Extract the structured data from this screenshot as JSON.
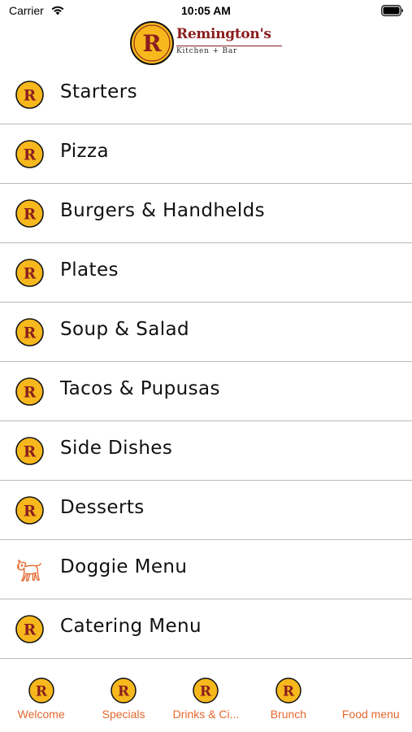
{
  "status_bar": {
    "carrier": "Carrier",
    "time": "10:05 AM"
  },
  "header": {
    "brand_name": "Remington's",
    "brand_sub": "Kitchen + Bar",
    "logo_letter": "R"
  },
  "colors": {
    "brand_red": "#8b1e1e",
    "badge_gold": "#f6b81d",
    "tab_orange": "#e4672e"
  },
  "menu": {
    "items": [
      {
        "label": "Starters",
        "icon": "remingtons-r-icon"
      },
      {
        "label": "Pizza",
        "icon": "remingtons-r-icon"
      },
      {
        "label": "Burgers & Handhelds",
        "icon": "remingtons-r-icon"
      },
      {
        "label": "Plates",
        "icon": "remingtons-r-icon"
      },
      {
        "label": "Soup & Salad",
        "icon": "remingtons-r-icon"
      },
      {
        "label": "Tacos & Pupusas",
        "icon": "remingtons-r-icon"
      },
      {
        "label": "Side Dishes",
        "icon": "remingtons-r-icon"
      },
      {
        "label": "Desserts",
        "icon": "remingtons-r-icon"
      },
      {
        "label": "Doggie Menu",
        "icon": "dog-icon"
      },
      {
        "label": "Catering Menu",
        "icon": "remingtons-r-icon"
      }
    ]
  },
  "tab_bar": {
    "tabs": [
      {
        "label": "Welcome",
        "icon": "remingtons-r-icon"
      },
      {
        "label": "Specials",
        "icon": "remingtons-r-icon"
      },
      {
        "label": "Drinks & Ci...",
        "icon": "remingtons-r-icon"
      },
      {
        "label": "Brunch",
        "icon": "remingtons-r-icon"
      },
      {
        "label": "Food menu",
        "icon": "none"
      }
    ]
  }
}
